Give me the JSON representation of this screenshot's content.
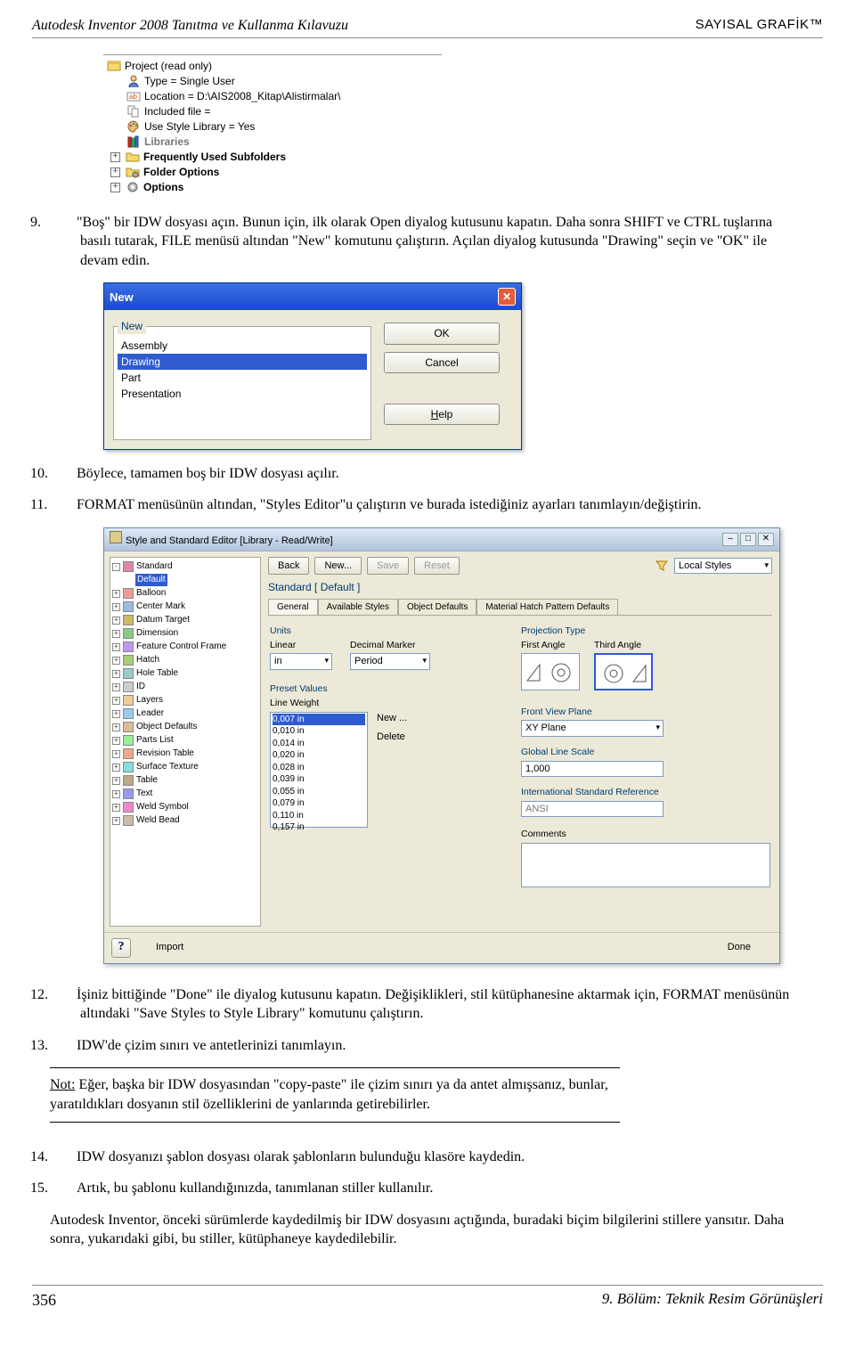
{
  "header": {
    "left": "Autodesk Inventor 2008 Tanıtma ve Kullanma Kılavuzu",
    "right": "SAYISAL GRAFİK™"
  },
  "footer": {
    "left": "356",
    "right": "9. Bölüm: Teknik Resim Görünüşleri"
  },
  "project_tree": {
    "root": "Project (read only)",
    "type": "Type = Single User",
    "location": "Location = D:\\AIS2008_Kitap\\Alistirmalar\\",
    "included": "Included file =",
    "style_lib": "Use Style Library = Yes",
    "libraries": "Libraries",
    "subfolders": "Frequently Used Subfolders",
    "folder_options": "Folder Options",
    "options": "Options"
  },
  "steps": {
    "s9": {
      "n": "9.",
      "t": "\"Boş\" bir IDW dosyası açın. Bunun için, ilk olarak Open diyalog kutusunu kapatın. Daha sonra SHIFT ve CTRL tuşlarına basılı tutarak, FILE menüsü altından \"New\" komutunu çalıştırın. Açılan diyalog kutusunda \"Drawing\" seçin ve \"OK\" ile devam edin."
    },
    "s10": {
      "n": "10.",
      "t": "Böylece, tamamen boş bir IDW dosyası açılır."
    },
    "s11": {
      "n": "11.",
      "t": "FORMAT menüsünün altından, \"Styles Editor\"u çalıştırın ve burada istediğiniz ayarları tanımlayın/değiştirin."
    },
    "s12": {
      "n": "12.",
      "t": "İşiniz bittiğinde \"Done\" ile diyalog kutusunu kapatın. Değişiklikleri, stil kütüphanesine aktarmak için, FORMAT menüsünün altındaki \"Save Styles to Style Library\" komutunu çalıştırın."
    },
    "s13": {
      "n": "13.",
      "t": "IDW'de çizim sınırı ve antetlerinizi tanımlayın."
    },
    "s14": {
      "n": "14.",
      "t": "IDW dosyanızı şablon dosyası olarak şablonların bulunduğu klasöre kaydedin."
    },
    "s15": {
      "n": "15.",
      "t": "Artık, bu şablonu kullandığınızda, tanımlanan stiller kullanılır."
    }
  },
  "note": "Not: Eğer, başka bir IDW dosyasından \"copy-paste\" ile çizim sınırı ya da antet almışsanız, bunlar, yaratıldıkları dosyanın stil özelliklerini de yanlarında getirebilirler.",
  "closing": "Autodesk Inventor, önceki sürümlerde kaydedilmiş bir IDW dosyasını açtığında, buradaki biçim bilgilerini stillere yansıtır. Daha sonra, yukarıdaki gibi, bu stiller, kütüphaneye kaydedilebilir.",
  "dlg_new": {
    "title": "New",
    "legend": "New",
    "items": [
      "Assembly",
      "Drawing",
      "Part",
      "Presentation"
    ],
    "ok": "OK",
    "cancel": "Cancel",
    "help": "Help",
    "help_accel": "H"
  },
  "dlg_se": {
    "title": "Style and Standard Editor [Library - Read/Write]",
    "tree": [
      {
        "pm": "-",
        "icon": "std",
        "label": "Standard",
        "children": [
          {
            "label": "Default",
            "sel": true
          }
        ]
      },
      {
        "pm": "+",
        "icon": "balloon",
        "label": "Balloon"
      },
      {
        "pm": "+",
        "icon": "cm",
        "label": "Center Mark"
      },
      {
        "pm": "+",
        "icon": "dt",
        "label": "Datum Target"
      },
      {
        "pm": "+",
        "icon": "dim",
        "label": "Dimension"
      },
      {
        "pm": "+",
        "icon": "fcf",
        "label": "Feature Control Frame"
      },
      {
        "pm": "+",
        "icon": "hatch",
        "label": "Hatch"
      },
      {
        "pm": "+",
        "icon": "ht",
        "label": "Hole Table"
      },
      {
        "pm": "+",
        "icon": "id",
        "label": "ID"
      },
      {
        "pm": "+",
        "icon": "layers",
        "label": "Layers"
      },
      {
        "pm": "+",
        "icon": "leader",
        "label": "Leader"
      },
      {
        "pm": "+",
        "icon": "od",
        "label": "Object Defaults"
      },
      {
        "pm": "+",
        "icon": "pl",
        "label": "Parts List"
      },
      {
        "pm": "+",
        "icon": "rt",
        "label": "Revision Table"
      },
      {
        "pm": "+",
        "icon": "st",
        "label": "Surface Texture"
      },
      {
        "pm": "+",
        "icon": "tbl",
        "label": "Table"
      },
      {
        "pm": "+",
        "icon": "txt",
        "label": "Text"
      },
      {
        "pm": "+",
        "icon": "ws",
        "label": "Weld Symbol"
      },
      {
        "pm": "+",
        "icon": "wb",
        "label": "Weld Bead"
      }
    ],
    "toolbar": {
      "back": "Back",
      "new": "New...",
      "save": "Save",
      "reset": "Reset",
      "filter_icon": "filter",
      "filter_combo": "Local Styles"
    },
    "heading": "Standard [ Default ]",
    "tabs": [
      "General",
      "Available Styles",
      "Object Defaults",
      "Material Hatch Pattern Defaults"
    ],
    "units_section": "Units",
    "linear_label": "Linear",
    "linear_value": "in",
    "decimal_label": "Decimal Marker",
    "decimal_value": "Period",
    "preset_section": "Preset Values",
    "lw_label": "Line Weight",
    "lw_values": [
      "0,007 in",
      "0,010 in",
      "0,014 in",
      "0,020 in",
      "0,028 in",
      "0,039 in",
      "0,055 in",
      "0,079 in",
      "0,110 in",
      "0,157 in"
    ],
    "btn_new": "New ...",
    "btn_delete": "Delete",
    "proj_section": "Projection Type",
    "first_angle": "First Angle",
    "third_angle": "Third Angle",
    "fvp_section": "Front View Plane",
    "fvp_value": "XY Plane",
    "gls_section": "Global Line Scale",
    "gls_value": "1,000",
    "isr_section": "International Standard Reference",
    "isr_value": "ANSI",
    "comments_label": "Comments",
    "import": "Import",
    "done": "Done",
    "help": "?"
  }
}
